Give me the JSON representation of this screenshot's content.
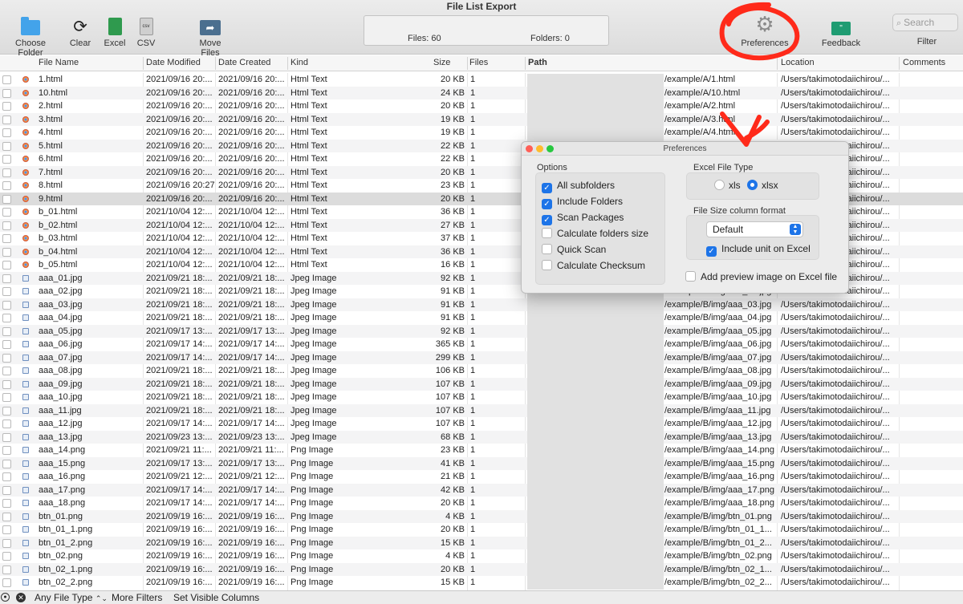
{
  "window": {
    "title": "File List Export"
  },
  "toolbar": {
    "choose_folder": "Choose Folder",
    "clear": "Clear",
    "excel": "Excel",
    "csv": "CSV",
    "csv_icon_text": "csv",
    "move_files": "Move Files",
    "files_summary": "Files: 60",
    "folders_summary": "Folders: 0",
    "preferences": "Preferences",
    "feedback": "Feedback",
    "feedback_icon_text": "\"",
    "search_placeholder": "Search",
    "filter": "Filter"
  },
  "columns": {
    "file_name": "File Name",
    "date_modified": "Date Modified",
    "date_created": "Date Created",
    "kind": "Kind",
    "size": "Size",
    "files": "Files",
    "path": "Path",
    "location": "Location",
    "comments": "Comments"
  },
  "rows": [
    {
      "name": "1.html",
      "modified": "2021/09/16 20:...",
      "created": "2021/09/16 20:...",
      "kind": "Html Text",
      "size": "20 KB",
      "files": "1",
      "path": "/example/A/1.html",
      "location": "/Users/takimotodaiichirou/...",
      "icon": "html"
    },
    {
      "name": "10.html",
      "modified": "2021/09/16 20:...",
      "created": "2021/09/16 20:...",
      "kind": "Html Text",
      "size": "24 KB",
      "files": "1",
      "path": "/example/A/10.html",
      "location": "/Users/takimotodaiichirou/...",
      "icon": "html"
    },
    {
      "name": "2.html",
      "modified": "2021/09/16 20:...",
      "created": "2021/09/16 20:...",
      "kind": "Html Text",
      "size": "20 KB",
      "files": "1",
      "path": "/example/A/2.html",
      "location": "/Users/takimotodaiichirou/...",
      "icon": "html"
    },
    {
      "name": "3.html",
      "modified": "2021/09/16 20:...",
      "created": "2021/09/16 20:...",
      "kind": "Html Text",
      "size": "19 KB",
      "files": "1",
      "path": "/example/A/3.html",
      "location": "/Users/takimotodaiichirou/...",
      "icon": "html"
    },
    {
      "name": "4.html",
      "modified": "2021/09/16 20:...",
      "created": "2021/09/16 20:...",
      "kind": "Html Text",
      "size": "19 KB",
      "files": "1",
      "path": "/example/A/4.html",
      "location": "/Users/takimotodaiichirou/...",
      "icon": "html"
    },
    {
      "name": "5.html",
      "modified": "2021/09/16 20:...",
      "created": "2021/09/16 20:...",
      "kind": "Html Text",
      "size": "22 KB",
      "files": "1",
      "path": "",
      "location": "/Users/takimotodaiichirou/...",
      "icon": "html"
    },
    {
      "name": "6.html",
      "modified": "2021/09/16 20:...",
      "created": "2021/09/16 20:...",
      "kind": "Html Text",
      "size": "22 KB",
      "files": "1",
      "path": "",
      "location": "/Users/takimotodaiichirou/...",
      "icon": "html"
    },
    {
      "name": "7.html",
      "modified": "2021/09/16 20:...",
      "created": "2021/09/16 20:...",
      "kind": "Html Text",
      "size": "20 KB",
      "files": "1",
      "path": "",
      "location": "/Users/takimotodaiichirou/...",
      "icon": "html"
    },
    {
      "name": "8.html",
      "modified": "2021/09/16 20:27:47",
      "created": "2021/09/16 20:...",
      "kind": "Html Text",
      "size": "23 KB",
      "files": "1",
      "path": "",
      "location": "/Users/takimotodaiichirou/...",
      "icon": "html"
    },
    {
      "name": "9.html",
      "modified": "2021/09/16 20:...",
      "created": "2021/09/16 20:...",
      "kind": "Html Text",
      "size": "20 KB",
      "files": "1",
      "path": "",
      "location": "/Users/takimotodaiichirou/...",
      "icon": "html",
      "selected": true
    },
    {
      "name": "b_01.html",
      "modified": "2021/10/04 12:...",
      "created": "2021/10/04 12:...",
      "kind": "Html Text",
      "size": "36 KB",
      "files": "1",
      "path": "",
      "location": "/Users/takimotodaiichirou/...",
      "icon": "html"
    },
    {
      "name": "b_02.html",
      "modified": "2021/10/04 12:...",
      "created": "2021/10/04 12:...",
      "kind": "Html Text",
      "size": "27 KB",
      "files": "1",
      "path": "",
      "location": "/Users/takimotodaiichirou/...",
      "icon": "html"
    },
    {
      "name": "b_03.html",
      "modified": "2021/10/04 12:...",
      "created": "2021/10/04 12:...",
      "kind": "Html Text",
      "size": "37 KB",
      "files": "1",
      "path": "",
      "location": "/Users/takimotodaiichirou/...",
      "icon": "html"
    },
    {
      "name": "b_04.html",
      "modified": "2021/10/04 12:...",
      "created": "2021/10/04 12:...",
      "kind": "Html Text",
      "size": "36 KB",
      "files": "1",
      "path": "",
      "location": "/Users/takimotodaiichirou/...",
      "icon": "html"
    },
    {
      "name": "b_05.html",
      "modified": "2021/10/04 12:...",
      "created": "2021/10/04 12:...",
      "kind": "Html Text",
      "size": "16 KB",
      "files": "1",
      "path": "",
      "location": "/Users/takimotodaiichirou/...",
      "icon": "html"
    },
    {
      "name": "aaa_01.jpg",
      "modified": "2021/09/21 18:...",
      "created": "2021/09/21 18:...",
      "kind": "Jpeg Image",
      "size": "92 KB",
      "files": "1",
      "path": "",
      "location": "/Users/takimotodaiichirou/...",
      "icon": "img"
    },
    {
      "name": "aaa_02.jpg",
      "modified": "2021/09/21 18:...",
      "created": "2021/09/21 18:...",
      "kind": "Jpeg Image",
      "size": "91 KB",
      "files": "1",
      "path": "/example/B/img/aaa_02.jpg",
      "location": "/Users/takimotodaiichirou/...",
      "icon": "img"
    },
    {
      "name": "aaa_03.jpg",
      "modified": "2021/09/21 18:...",
      "created": "2021/09/21 18:...",
      "kind": "Jpeg Image",
      "size": "91 KB",
      "files": "1",
      "path": "/example/B/img/aaa_03.jpg",
      "location": "/Users/takimotodaiichirou/...",
      "icon": "img"
    },
    {
      "name": "aaa_04.jpg",
      "modified": "2021/09/21 18:...",
      "created": "2021/09/21 18:...",
      "kind": "Jpeg Image",
      "size": "91 KB",
      "files": "1",
      "path": "/example/B/img/aaa_04.jpg",
      "location": "/Users/takimotodaiichirou/...",
      "icon": "img"
    },
    {
      "name": "aaa_05.jpg",
      "modified": "2021/09/17 13:...",
      "created": "2021/09/17 13:...",
      "kind": "Jpeg Image",
      "size": "92 KB",
      "files": "1",
      "path": "/example/B/img/aaa_05.jpg",
      "location": "/Users/takimotodaiichirou/...",
      "icon": "img"
    },
    {
      "name": "aaa_06.jpg",
      "modified": "2021/09/17 14:...",
      "created": "2021/09/17 14:...",
      "kind": "Jpeg Image",
      "size": "365 KB",
      "files": "1",
      "path": "/example/B/img/aaa_06.jpg",
      "location": "/Users/takimotodaiichirou/...",
      "icon": "img"
    },
    {
      "name": "aaa_07.jpg",
      "modified": "2021/09/17 14:...",
      "created": "2021/09/17 14:...",
      "kind": "Jpeg Image",
      "size": "299 KB",
      "files": "1",
      "path": "/example/B/img/aaa_07.jpg",
      "location": "/Users/takimotodaiichirou/...",
      "icon": "img"
    },
    {
      "name": "aaa_08.jpg",
      "modified": "2021/09/21 18:...",
      "created": "2021/09/21 18:...",
      "kind": "Jpeg Image",
      "size": "106 KB",
      "files": "1",
      "path": "/example/B/img/aaa_08.jpg",
      "location": "/Users/takimotodaiichirou/...",
      "icon": "img"
    },
    {
      "name": "aaa_09.jpg",
      "modified": "2021/09/21 18:...",
      "created": "2021/09/21 18:...",
      "kind": "Jpeg Image",
      "size": "107 KB",
      "files": "1",
      "path": "/example/B/img/aaa_09.jpg",
      "location": "/Users/takimotodaiichirou/...",
      "icon": "img"
    },
    {
      "name": "aaa_10.jpg",
      "modified": "2021/09/21 18:...",
      "created": "2021/09/21 18:...",
      "kind": "Jpeg Image",
      "size": "107 KB",
      "files": "1",
      "path": "/example/B/img/aaa_10.jpg",
      "location": "/Users/takimotodaiichirou/...",
      "icon": "img"
    },
    {
      "name": "aaa_11.jpg",
      "modified": "2021/09/21 18:...",
      "created": "2021/09/21 18:...",
      "kind": "Jpeg Image",
      "size": "107 KB",
      "files": "1",
      "path": "/example/B/img/aaa_11.jpg",
      "location": "/Users/takimotodaiichirou/...",
      "icon": "img"
    },
    {
      "name": "aaa_12.jpg",
      "modified": "2021/09/17 14:...",
      "created": "2021/09/17 14:...",
      "kind": "Jpeg Image",
      "size": "107 KB",
      "files": "1",
      "path": "/example/B/img/aaa_12.jpg",
      "location": "/Users/takimotodaiichirou/...",
      "icon": "img"
    },
    {
      "name": "aaa_13.jpg",
      "modified": "2021/09/23 13:...",
      "created": "2021/09/23 13:...",
      "kind": "Jpeg Image",
      "size": "68 KB",
      "files": "1",
      "path": "/example/B/img/aaa_13.jpg",
      "location": "/Users/takimotodaiichirou/...",
      "icon": "img"
    },
    {
      "name": "aaa_14.png",
      "modified": "2021/09/21 11:...",
      "created": "2021/09/21 11:...",
      "kind": "Png Image",
      "size": "23 KB",
      "files": "1",
      "path": "/example/B/img/aaa_14.png",
      "location": "/Users/takimotodaiichirou/...",
      "icon": "img"
    },
    {
      "name": "aaa_15.png",
      "modified": "2021/09/17 13:...",
      "created": "2021/09/17 13:...",
      "kind": "Png Image",
      "size": "41 KB",
      "files": "1",
      "path": "/example/B/img/aaa_15.png",
      "location": "/Users/takimotodaiichirou/...",
      "icon": "img"
    },
    {
      "name": "aaa_16.png",
      "modified": "2021/09/21 12:...",
      "created": "2021/09/21 12:...",
      "kind": "Png Image",
      "size": "21 KB",
      "files": "1",
      "path": "/example/B/img/aaa_16.png",
      "location": "/Users/takimotodaiichirou/...",
      "icon": "img"
    },
    {
      "name": "aaa_17.png",
      "modified": "2021/09/17 14:...",
      "created": "2021/09/17 14:...",
      "kind": "Png Image",
      "size": "42 KB",
      "files": "1",
      "path": "/example/B/img/aaa_17.png",
      "location": "/Users/takimotodaiichirou/...",
      "icon": "img"
    },
    {
      "name": "aaa_18.png",
      "modified": "2021/09/17 14:...",
      "created": "2021/09/17 14:...",
      "kind": "Png Image",
      "size": "20 KB",
      "files": "1",
      "path": "/example/B/img/aaa_18.png",
      "location": "/Users/takimotodaiichirou/...",
      "icon": "img"
    },
    {
      "name": "btn_01.png",
      "modified": "2021/09/19 16:...",
      "created": "2021/09/19 16:...",
      "kind": "Png Image",
      "size": "4 KB",
      "files": "1",
      "path": "/example/B/img/btn_01.png",
      "location": "/Users/takimotodaiichirou/...",
      "icon": "img"
    },
    {
      "name": "btn_01_1.png",
      "modified": "2021/09/19 16:...",
      "created": "2021/09/19 16:...",
      "kind": "Png Image",
      "size": "20 KB",
      "files": "1",
      "path": "/example/B/img/btn_01_1...",
      "location": "/Users/takimotodaiichirou/...",
      "icon": "img"
    },
    {
      "name": "btn_01_2.png",
      "modified": "2021/09/19 16:...",
      "created": "2021/09/19 16:...",
      "kind": "Png Image",
      "size": "15 KB",
      "files": "1",
      "path": "/example/B/img/btn_01_2...",
      "location": "/Users/takimotodaiichirou/...",
      "icon": "img"
    },
    {
      "name": "btn_02.png",
      "modified": "2021/09/19 16:...",
      "created": "2021/09/19 16:...",
      "kind": "Png Image",
      "size": "4 KB",
      "files": "1",
      "path": "/example/B/img/btn_02.png",
      "location": "/Users/takimotodaiichirou/...",
      "icon": "img"
    },
    {
      "name": "btn_02_1.png",
      "modified": "2021/09/19 16:...",
      "created": "2021/09/19 16:...",
      "kind": "Png Image",
      "size": "20 KB",
      "files": "1",
      "path": "/example/B/img/btn_02_1...",
      "location": "/Users/takimotodaiichirou/...",
      "icon": "img"
    },
    {
      "name": "btn_02_2.png",
      "modified": "2021/09/19 16:...",
      "created": "2021/09/19 16:...",
      "kind": "Png Image",
      "size": "15 KB",
      "files": "1",
      "path": "/example/B/img/btn_02_2...",
      "location": "/Users/takimotodaiichirou/...",
      "icon": "img"
    }
  ],
  "preferences": {
    "title": "Preferences",
    "options_label": "Options",
    "options": [
      {
        "label": "All subfolders",
        "checked": true
      },
      {
        "label": "Include Folders",
        "checked": true
      },
      {
        "label": "Scan Packages",
        "checked": true
      },
      {
        "label": "Calculate folders size",
        "checked": false
      },
      {
        "label": "Quick Scan",
        "checked": false
      },
      {
        "label": "Calculate Checksum",
        "checked": false
      }
    ],
    "excel_type_label": "Excel File Type",
    "xls_label": "xls",
    "xlsx_label": "xlsx",
    "selected_excel_type": "xlsx",
    "size_format_label": "File Size column format",
    "size_format_value": "Default",
    "include_unit_label": "Include unit on Excel",
    "include_unit_checked": true,
    "preview_label": "Add preview image on Excel file",
    "preview_checked": false
  },
  "bottom_bar": {
    "file_type_filter": "Any File Type",
    "more_filters": "More Filters",
    "visible_columns": "Set Visible Columns"
  },
  "colors": {
    "accent": "#1d74e8",
    "annotation": "#ff2a1a"
  }
}
